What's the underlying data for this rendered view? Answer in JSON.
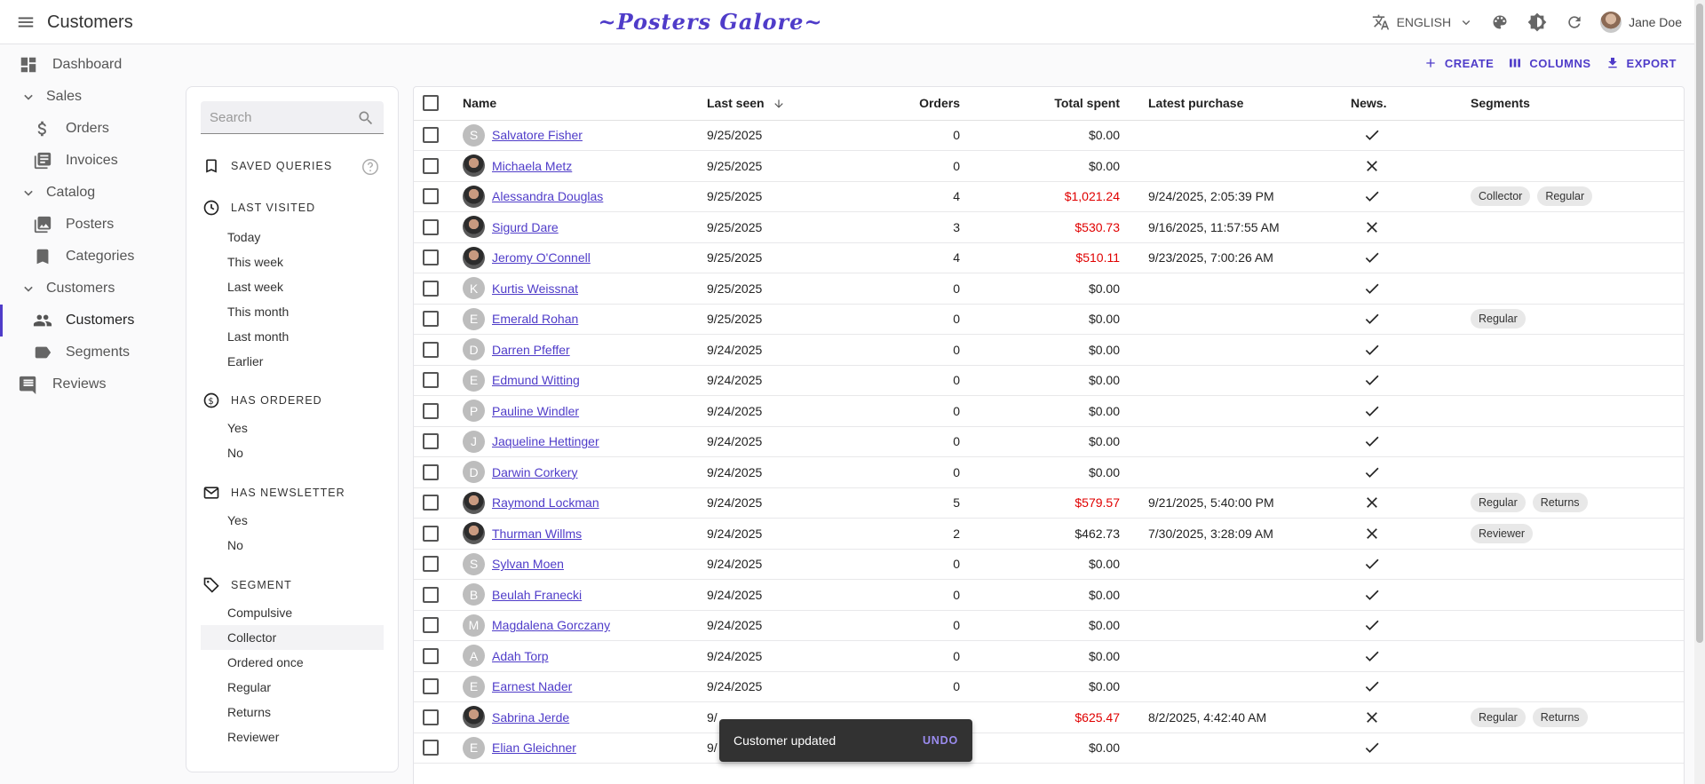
{
  "app": {
    "title": "Customers",
    "brand": "~Posters Galore~",
    "language": "ENGLISH",
    "user_name": "Jane Doe"
  },
  "sidebar": {
    "items": [
      {
        "label": "Dashboard",
        "icon": "dashboard-icon"
      },
      {
        "label": "Sales",
        "icon": "chevron-down-icon"
      },
      {
        "label": "Orders",
        "icon": "dollar-icon"
      },
      {
        "label": "Invoices",
        "icon": "invoice-icon"
      },
      {
        "label": "Catalog",
        "icon": "chevron-down-icon"
      },
      {
        "label": "Posters",
        "icon": "image-icon"
      },
      {
        "label": "Categories",
        "icon": "bookmark-icon"
      },
      {
        "label": "Customers",
        "icon": "chevron-down-icon"
      },
      {
        "label": "Customers",
        "icon": "people-icon"
      },
      {
        "label": "Segments",
        "icon": "label-icon"
      },
      {
        "label": "Reviews",
        "icon": "comment-icon"
      }
    ]
  },
  "filters": {
    "search_placeholder": "Search",
    "saved_queries": "SAVED QUERIES",
    "last_visited": {
      "title": "LAST VISITED",
      "options": [
        "Today",
        "This week",
        "Last week",
        "This month",
        "Last month",
        "Earlier"
      ]
    },
    "has_ordered": {
      "title": "HAS ORDERED",
      "options": [
        "Yes",
        "No"
      ]
    },
    "has_newsletter": {
      "title": "HAS NEWSLETTER",
      "options": [
        "Yes",
        "No"
      ]
    },
    "segment": {
      "title": "SEGMENT",
      "options": [
        "Compulsive",
        "Collector",
        "Ordered once",
        "Regular",
        "Returns",
        "Reviewer"
      ],
      "selected": "Collector"
    }
  },
  "toolbar": {
    "create": "CREATE",
    "columns": "COLUMNS",
    "export": "EXPORT"
  },
  "table": {
    "headers": {
      "name": "Name",
      "last_seen": "Last seen",
      "orders": "Orders",
      "total_spent": "Total spent",
      "latest_purchase": "Latest purchase",
      "news": "News.",
      "segments": "Segments"
    },
    "rows": [
      {
        "initial": "S",
        "photo": false,
        "name": "Salvatore Fisher",
        "last_seen": "9/25/2025",
        "orders": "0",
        "total": "$0.00",
        "highlight": false,
        "latest": "",
        "news": true,
        "segments": []
      },
      {
        "initial": "",
        "photo": true,
        "name": "Michaela Metz",
        "last_seen": "9/25/2025",
        "orders": "0",
        "total": "$0.00",
        "highlight": false,
        "latest": "",
        "news": false,
        "segments": []
      },
      {
        "initial": "",
        "photo": true,
        "name": "Alessandra Douglas",
        "last_seen": "9/25/2025",
        "orders": "4",
        "total": "$1,021.24",
        "highlight": true,
        "latest": "9/24/2025, 2:05:39 PM",
        "news": true,
        "segments": [
          "Collector",
          "Regular"
        ]
      },
      {
        "initial": "",
        "photo": true,
        "name": "Sigurd Dare",
        "last_seen": "9/25/2025",
        "orders": "3",
        "total": "$530.73",
        "highlight": true,
        "latest": "9/16/2025, 11:57:55 AM",
        "news": false,
        "segments": []
      },
      {
        "initial": "",
        "photo": true,
        "name": "Jeromy O'Connell",
        "last_seen": "9/25/2025",
        "orders": "4",
        "total": "$510.11",
        "highlight": true,
        "latest": "9/23/2025, 7:00:26 AM",
        "news": true,
        "segments": []
      },
      {
        "initial": "K",
        "photo": false,
        "name": "Kurtis Weissnat",
        "last_seen": "9/25/2025",
        "orders": "0",
        "total": "$0.00",
        "highlight": false,
        "latest": "",
        "news": true,
        "segments": []
      },
      {
        "initial": "E",
        "photo": false,
        "name": "Emerald Rohan",
        "last_seen": "9/25/2025",
        "orders": "0",
        "total": "$0.00",
        "highlight": false,
        "latest": "",
        "news": true,
        "segments": [
          "Regular"
        ]
      },
      {
        "initial": "D",
        "photo": false,
        "name": "Darren Pfeffer",
        "last_seen": "9/24/2025",
        "orders": "0",
        "total": "$0.00",
        "highlight": false,
        "latest": "",
        "news": true,
        "segments": []
      },
      {
        "initial": "E",
        "photo": false,
        "name": "Edmund Witting",
        "last_seen": "9/24/2025",
        "orders": "0",
        "total": "$0.00",
        "highlight": false,
        "latest": "",
        "news": true,
        "segments": []
      },
      {
        "initial": "P",
        "photo": false,
        "name": "Pauline Windler",
        "last_seen": "9/24/2025",
        "orders": "0",
        "total": "$0.00",
        "highlight": false,
        "latest": "",
        "news": true,
        "segments": []
      },
      {
        "initial": "J",
        "photo": false,
        "name": "Jaqueline Hettinger",
        "last_seen": "9/24/2025",
        "orders": "0",
        "total": "$0.00",
        "highlight": false,
        "latest": "",
        "news": true,
        "segments": []
      },
      {
        "initial": "D",
        "photo": false,
        "name": "Darwin Corkery",
        "last_seen": "9/24/2025",
        "orders": "0",
        "total": "$0.00",
        "highlight": false,
        "latest": "",
        "news": true,
        "segments": []
      },
      {
        "initial": "",
        "photo": true,
        "name": "Raymond Lockman",
        "last_seen": "9/24/2025",
        "orders": "5",
        "total": "$579.57",
        "highlight": true,
        "latest": "9/21/2025, 5:40:00 PM",
        "news": false,
        "segments": [
          "Regular",
          "Returns"
        ]
      },
      {
        "initial": "",
        "photo": true,
        "name": "Thurman Willms",
        "last_seen": "9/24/2025",
        "orders": "2",
        "total": "$462.73",
        "highlight": false,
        "latest": "7/30/2025, 3:28:09 AM",
        "news": false,
        "segments": [
          "Reviewer"
        ]
      },
      {
        "initial": "S",
        "photo": false,
        "name": "Sylvan Moen",
        "last_seen": "9/24/2025",
        "orders": "0",
        "total": "$0.00",
        "highlight": false,
        "latest": "",
        "news": true,
        "segments": []
      },
      {
        "initial": "B",
        "photo": false,
        "name": "Beulah Franecki",
        "last_seen": "9/24/2025",
        "orders": "0",
        "total": "$0.00",
        "highlight": false,
        "latest": "",
        "news": true,
        "segments": []
      },
      {
        "initial": "M",
        "photo": false,
        "name": "Magdalena Gorczany",
        "last_seen": "9/24/2025",
        "orders": "0",
        "total": "$0.00",
        "highlight": false,
        "latest": "",
        "news": true,
        "segments": []
      },
      {
        "initial": "A",
        "photo": false,
        "name": "Adah Torp",
        "last_seen": "9/24/2025",
        "orders": "0",
        "total": "$0.00",
        "highlight": false,
        "latest": "",
        "news": true,
        "segments": []
      },
      {
        "initial": "E",
        "photo": false,
        "name": "Earnest Nader",
        "last_seen": "9/24/2025",
        "orders": "0",
        "total": "$0.00",
        "highlight": false,
        "latest": "",
        "news": true,
        "segments": []
      },
      {
        "initial": "",
        "photo": true,
        "name": "Sabrina Jerde",
        "last_seen": "9/",
        "orders": "",
        "total": "$625.47",
        "highlight": true,
        "latest": "8/2/2025, 4:42:40 AM",
        "news": false,
        "segments": [
          "Regular",
          "Returns"
        ]
      },
      {
        "initial": "E",
        "photo": false,
        "name": "Elian Gleichner",
        "last_seen": "9/",
        "orders": "",
        "total": "$0.00",
        "highlight": false,
        "latest": "",
        "news": true,
        "segments": []
      }
    ]
  },
  "snackbar": {
    "message": "Customer updated",
    "action": "UNDO"
  },
  "colors": {
    "accent": "#4f3cc9",
    "highlight_value": "#e00000"
  }
}
